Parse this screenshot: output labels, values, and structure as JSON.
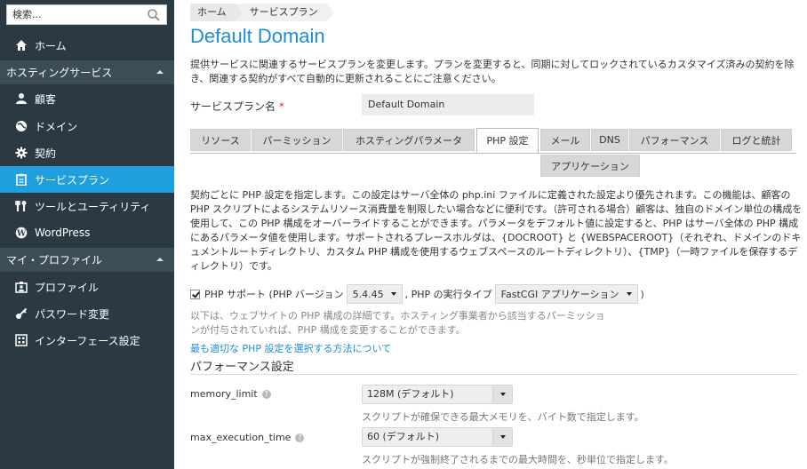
{
  "search": {
    "placeholder": "検索..."
  },
  "sidebar": {
    "home": "ホーム",
    "hosting_section": "ホスティングサービス",
    "hosting_items": [
      "顧客",
      "ドメイン",
      "契約",
      "サービスプラン",
      "ツールとユーティリティ",
      "WordPress"
    ],
    "profile_section": "マイ・プロファイル",
    "profile_items": [
      "プロファイル",
      "パスワード変更",
      "インターフェース設定"
    ],
    "active_item": "サービスプラン",
    "active_color": "#1fa0dc"
  },
  "breadcrumb": [
    "ホーム",
    "サービスプラン"
  ],
  "page": {
    "title": "Default Domain",
    "intro": "提供サービスに関連するサービスプランを変更します。プランを変更すると、同期に対してロックされているカスタマイズ済みの契約を除き、関連する契約がすべて自動的に更新されることにご注意ください。",
    "plan_name_label": "サービスプラン名",
    "plan_name_required": "*",
    "plan_name_value": "Default Domain"
  },
  "tabs": [
    "リソース",
    "パーミッション",
    "ホスティングパラメータ",
    "PHP 設定",
    "メール",
    "DNS",
    "パフォーマンス",
    "ログと統計",
    "アプリケーション"
  ],
  "active_tab": "PHP 設定",
  "php": {
    "description": "契約ごとに PHP 設定を指定します。この設定はサーバ全体の php.ini ファイルに定義された設定より優先されます。この機能は、顧客の PHP スクリプトによるシステムリソース消費量を制限したい場合などに便利です。（許可される場合）顧客は、独自のドメイン単位の構成を使用して、この PHP 構成をオーバーライドすることができます。パラメータをデフォルト値に設定すると、PHP はサーバ全体の PHP 構成にあるパラメータ値を使用します。サポートされるプレースホルダは、{DOCROOT} と {WEBSPACEROOT}（それぞれ、ドメインのドキュメントルートディレクトリ、カスタム PHP 構成を使用するウェブスペースのルートディレクトリ）、{TMP}（一時ファイルを保存するディレクトリ）です。",
    "support_label": "PHP サポート (PHP バージョン",
    "version": "5.4.45",
    "runtime_label": ", PHP の実行タイプ",
    "runtime": "FastCGI アプリケーション",
    "close_paren": ")",
    "note": "以下は、ウェブサイトの PHP 構成の詳細です。ホスティング事業者から該当するパーミッションが付与されていれば、PHP 構成を変更することができます。",
    "link": "最も適切な PHP 設定を選択する方法について",
    "section_title": "パフォーマンス設定"
  },
  "fields": [
    {
      "label": "memory_limit",
      "value": "128M (デフォルト)",
      "hint": "スクリプトが確保できる最大メモリを、バイト数で指定します。"
    },
    {
      "label": "max_execution_time",
      "value": "60 (デフォルト)",
      "hint": "スクリプトが強制終了されるまでの最大時間を、秒単位で指定します。"
    }
  ]
}
